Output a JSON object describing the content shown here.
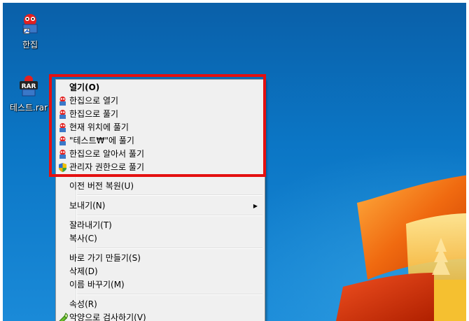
{
  "desktop": {
    "icons": [
      {
        "label": "한집",
        "icon": "hanzip-app-icon"
      },
      {
        "label": "테스트.rar",
        "icon": "rar-archive-icon"
      }
    ]
  },
  "menu": {
    "open": "열기(O)",
    "hanzip_items": [
      "한집으로 열기",
      "한집으로 풀기",
      "현재 위치에 풀기",
      "\"테스트₩\"에 풀기",
      "한집으로 알아서 풀기"
    ],
    "admin_extract": "관리자 권한으로 풀기",
    "restore_previous": "이전 버전 복원(U)",
    "send_to": "보내기(N)",
    "cut": "잘라내기(T)",
    "copy": "복사(C)",
    "create_shortcut": "바로 가기 만들기(S)",
    "delete": "삭제(D)",
    "rename": "이름 바꾸기(M)",
    "properties": "속성(R)",
    "scan": "악양으로 검사하기(V)"
  },
  "colors": {
    "highlight_border": "#e41010",
    "desktop_blue": "#0b76c5"
  }
}
